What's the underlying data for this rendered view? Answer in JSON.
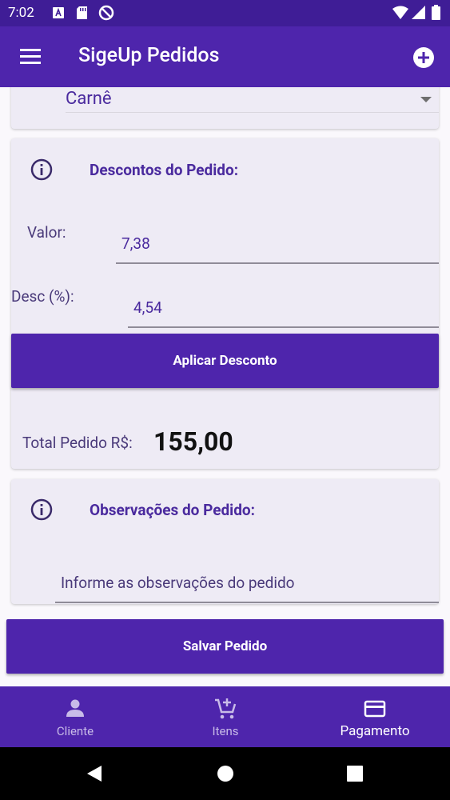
{
  "status_bar": {
    "time": "7:02"
  },
  "app_bar": {
    "title": "SigeUp Pedidos"
  },
  "payment": {
    "method": "Carnê"
  },
  "discount": {
    "heading": "Descontos do Pedido:",
    "valor_label": "Valor:",
    "valor_value": "7,38",
    "desc_label": "Desc (%):",
    "desc_value": "4,54",
    "apply_button": "Aplicar Desconto"
  },
  "total": {
    "label": "Total Pedido R$:",
    "value": "155,00"
  },
  "observations": {
    "heading": "Observações do Pedido:",
    "placeholder": "Informe as observações do pedido"
  },
  "save_button": "Salvar Pedido",
  "bottom_nav": {
    "tabs": [
      {
        "label": "Cliente",
        "icon": "person-icon",
        "active": false
      },
      {
        "label": "Itens",
        "icon": "cart-add-icon",
        "active": false
      },
      {
        "label": "Pagamento",
        "icon": "credit-card-icon",
        "active": true
      }
    ]
  },
  "colors": {
    "primary": "#4e25ac",
    "status_bar": "#3f1d96",
    "accent_text": "#4a2a9e"
  }
}
